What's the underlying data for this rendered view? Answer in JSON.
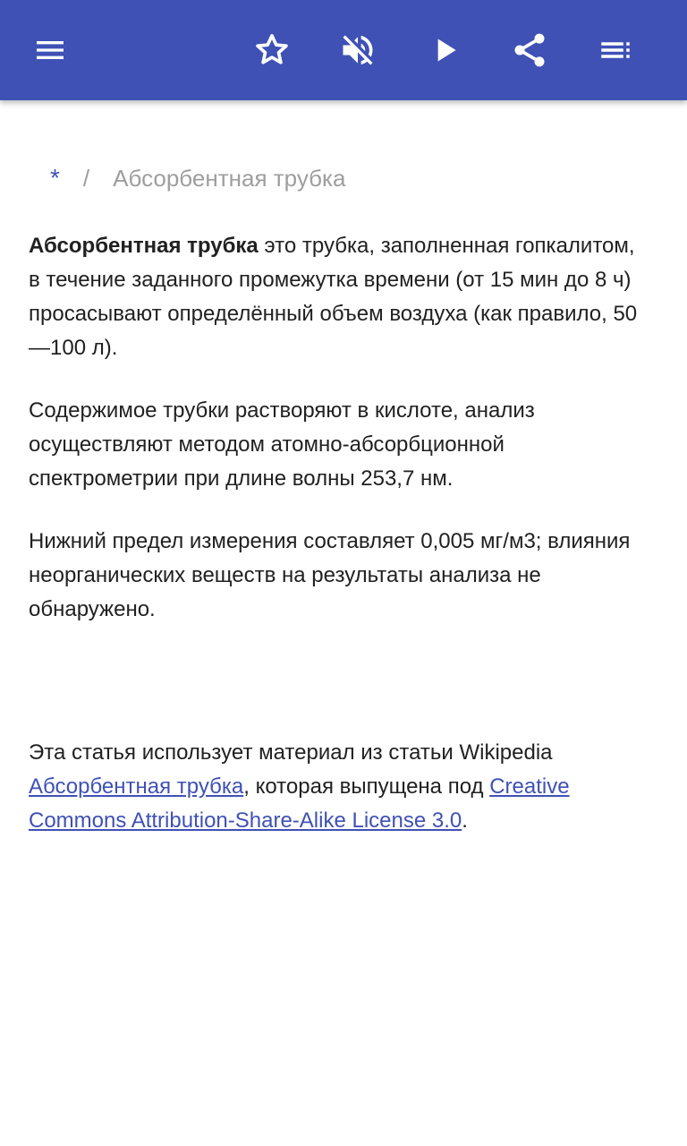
{
  "toolbar": {
    "menu_icon": "menu-icon",
    "favorite_icon": "star-outline-icon",
    "mute_icon": "volume-off-icon",
    "play_icon": "play-icon",
    "share_icon": "share-icon",
    "toc_icon": "toc-list-icon",
    "background_color": "#3f51b5",
    "icon_color": "#ffffff"
  },
  "breadcrumb": {
    "home": "*",
    "separator": "/",
    "current": "Абсорбентная трубка"
  },
  "article": {
    "term": "Абсорбентная трубка",
    "intro_rest": " это трубка, заполненная гопкалитом, в течение заданного промежутка времени (от 15 мин до 8 ч) просасывают определённый объем воздуха (как правило, 50—100 л).",
    "paragraph2": "Содержимое трубки растворяют в кислоте, анализ осуществляют методом атомно-абсорбционной спектрометрии при длине волны 253,7 нм.",
    "paragraph3": "Нижний предел измерения составляет 0,005 мг/м3; влияния неорганических веществ на результаты анализа не обнаружено."
  },
  "attribution": {
    "prefix": "Эта статья использует материал из статьи Wikipedia ",
    "article_link": "Абсорбентная трубка",
    "middle": ", которая выпущена под ",
    "license_link": "Creative Commons Attribution-Share-Alike License 3.0",
    "suffix": "."
  },
  "colors": {
    "primary": "#3f51b5",
    "text": "#212121",
    "muted": "#9e9e9e"
  }
}
